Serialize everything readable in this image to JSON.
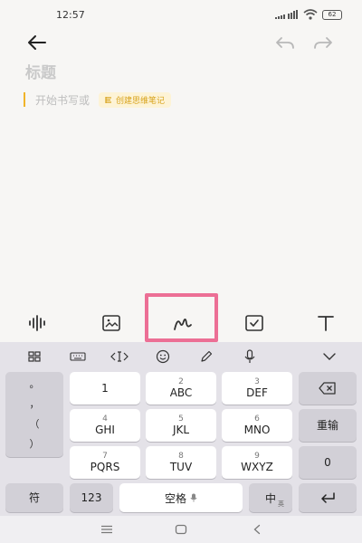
{
  "status_bar": {
    "time": "12:57",
    "battery": "62"
  },
  "note": {
    "title_placeholder": "标题",
    "body_placeholder": "开始书写或",
    "mindmap_chip": "创建思维笔记"
  },
  "edit_toolbar": {
    "tools": [
      "audio-wave-icon",
      "image-icon",
      "handwriting-icon",
      "checklist-icon",
      "text-format-icon"
    ],
    "highlighted_tool": "handwriting-icon",
    "highlight_color": "#ec6f95"
  },
  "keyboard": {
    "punctuation": [
      "。",
      "，",
      "（",
      "）"
    ],
    "keys": {
      "k1": {
        "num": "",
        "letters": "1"
      },
      "k2": {
        "num": "2",
        "letters": "ABC"
      },
      "k3": {
        "num": "3",
        "letters": "DEF"
      },
      "k4": {
        "num": "4",
        "letters": "GHI"
      },
      "k5": {
        "num": "5",
        "letters": "JKL"
      },
      "k6": {
        "num": "6",
        "letters": "MNO"
      },
      "k7": {
        "num": "7",
        "letters": "PQRS"
      },
      "k8": {
        "num": "8",
        "letters": "TUV"
      },
      "k9": {
        "num": "9",
        "letters": "WXYZ"
      }
    },
    "enter_label": "重输",
    "zero_label": "0",
    "symbol_label": "符",
    "num_label": "123",
    "space_label": "空格",
    "lang_label": "中",
    "lang_sub": "英"
  },
  "colors": {
    "accent": "#f0b429",
    "chip_text": "#d8a31c",
    "chip_bg": "#fdf3d6"
  }
}
